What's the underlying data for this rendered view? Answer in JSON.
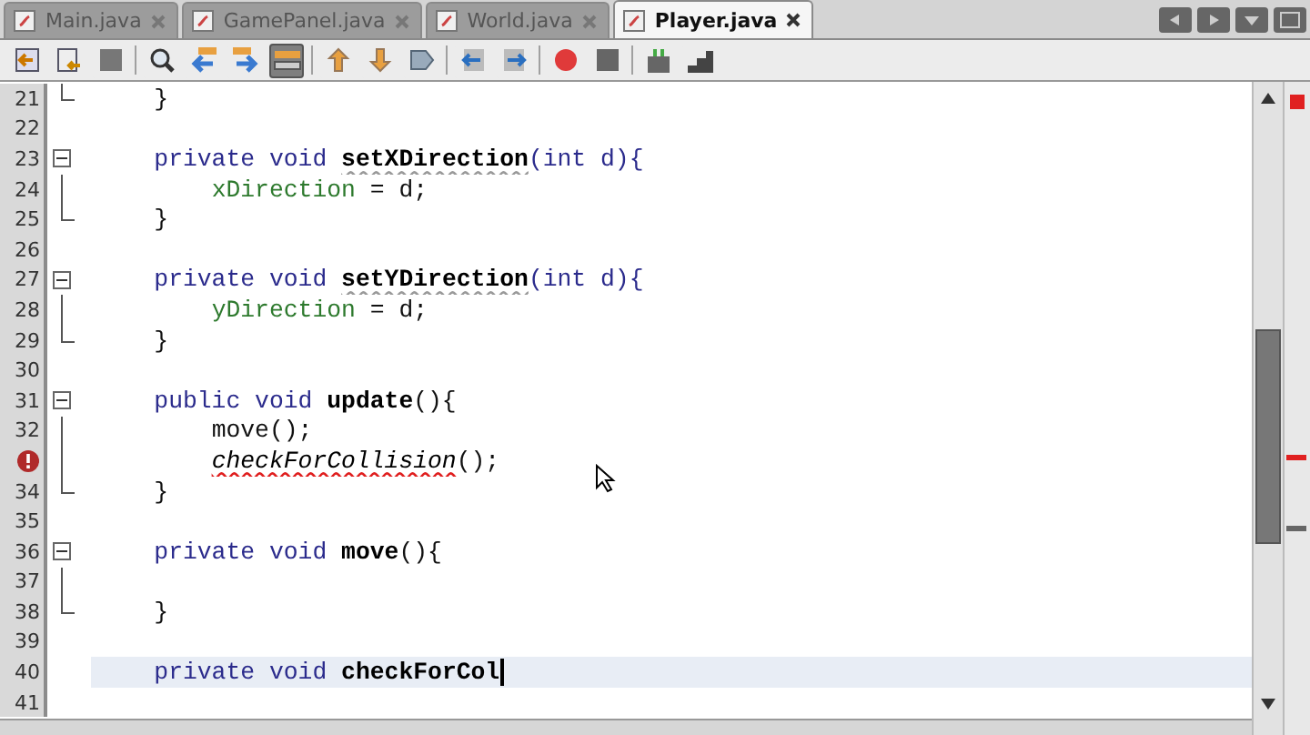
{
  "tabs": [
    {
      "label": "Main.java",
      "selected": false
    },
    {
      "label": "GamePanel.java",
      "selected": false
    },
    {
      "label": "World.java",
      "selected": false
    },
    {
      "label": "Player.java",
      "selected": true
    }
  ],
  "toolbar": [
    [
      {
        "kind": "back",
        "selected": false
      },
      {
        "kind": "history",
        "selected": false
      },
      {
        "kind": "blank",
        "selected": false
      }
    ],
    [
      {
        "kind": "find",
        "selected": false
      },
      {
        "kind": "prev",
        "selected": false
      },
      {
        "kind": "next",
        "selected": false
      },
      {
        "kind": "highlight",
        "selected": true
      }
    ],
    [
      {
        "kind": "up",
        "selected": false
      },
      {
        "kind": "down",
        "selected": false
      },
      {
        "kind": "bookmark",
        "selected": false
      }
    ],
    [
      {
        "kind": "shift-left",
        "selected": false
      },
      {
        "kind": "shift-right",
        "selected": false
      }
    ],
    [
      {
        "kind": "record",
        "selected": false
      },
      {
        "kind": "stop",
        "selected": false
      }
    ],
    [
      {
        "kind": "macro",
        "selected": false
      },
      {
        "kind": "step",
        "selected": false
      }
    ]
  ],
  "lines": [
    {
      "number": "21",
      "fold": {
        "kind": "end"
      },
      "current": false,
      "tokens": [
        {
          "t": "    }",
          "kind": "plain"
        }
      ]
    },
    {
      "number": "22",
      "current": false
    },
    {
      "number": "23",
      "fold": {
        "kind": "start"
      },
      "current": false,
      "tokens": [
        {
          "t": "    private void ",
          "kind": "keyword"
        },
        {
          "t": "setXDirection",
          "kind": "warning"
        },
        {
          "t": "(int d){",
          "kind": "keyword"
        }
      ]
    },
    {
      "number": "24",
      "fold": {
        "kind": "line"
      },
      "current": false,
      "tokens": [
        {
          "t": "        xDirection",
          "kind": "field"
        },
        {
          "t": " = d;",
          "kind": "plain"
        }
      ]
    },
    {
      "number": "25",
      "fold": {
        "kind": "end"
      },
      "current": false,
      "tokens": [
        {
          "t": "    }",
          "kind": "plain"
        }
      ]
    },
    {
      "number": "26",
      "current": false
    },
    {
      "number": "27",
      "fold": {
        "kind": "start"
      },
      "current": false,
      "tokens": [
        {
          "t": "    private void ",
          "kind": "keyword"
        },
        {
          "t": "setYDirection",
          "kind": "warning"
        },
        {
          "t": "(int d){",
          "kind": "keyword"
        }
      ]
    },
    {
      "number": "28",
      "fold": {
        "kind": "line"
      },
      "current": false,
      "tokens": [
        {
          "t": "        yDirection",
          "kind": "field"
        },
        {
          "t": " = d;",
          "kind": "plain"
        }
      ]
    },
    {
      "number": "29",
      "fold": {
        "kind": "end"
      },
      "current": false,
      "tokens": [
        {
          "t": "    }",
          "kind": "plain"
        }
      ]
    },
    {
      "number": "30",
      "current": false
    },
    {
      "number": "31",
      "fold": {
        "kind": "start"
      },
      "current": false,
      "tokens": [
        {
          "t": "    public void ",
          "kind": "keyword"
        },
        {
          "t": "update",
          "kind": "method"
        },
        {
          "t": "(){",
          "kind": "plain"
        }
      ]
    },
    {
      "number": "32",
      "fold": {
        "kind": "line"
      },
      "current": false,
      "tokens": [
        {
          "t": "        move();",
          "kind": "plain"
        }
      ]
    },
    {
      "fold": {
        "kind": "line"
      },
      "current": false,
      "error": true,
      "tokens": [
        {
          "t": "        checkForCollision",
          "kind": "error"
        },
        {
          "t": "();",
          "kind": "plain"
        }
      ]
    },
    {
      "number": "34",
      "fold": {
        "kind": "end"
      },
      "current": false,
      "tokens": [
        {
          "t": "    }",
          "kind": "plain"
        }
      ]
    },
    {
      "number": "35",
      "current": false
    },
    {
      "number": "36",
      "fold": {
        "kind": "start"
      },
      "current": false,
      "tokens": [
        {
          "t": "    private void ",
          "kind": "keyword"
        },
        {
          "t": "move",
          "kind": "method"
        },
        {
          "t": "(){",
          "kind": "plain"
        }
      ]
    },
    {
      "number": "37",
      "fold": {
        "kind": "line"
      },
      "current": false
    },
    {
      "number": "38",
      "fold": {
        "kind": "end"
      },
      "current": false,
      "tokens": [
        {
          "t": "    }",
          "kind": "plain"
        }
      ]
    },
    {
      "number": "39",
      "current": false
    },
    {
      "number": "40",
      "current": true,
      "tokens": [
        {
          "t": "    private void ",
          "kind": "keyword"
        },
        {
          "t": "checkForCol",
          "kind": "method"
        }
      ]
    },
    {
      "number": "41",
      "current": false
    }
  ]
}
